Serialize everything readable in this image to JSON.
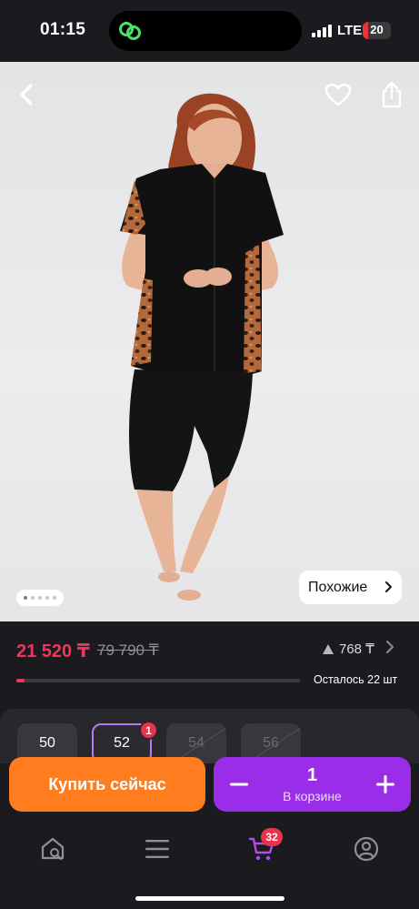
{
  "status_bar": {
    "time": "01:15",
    "network": "LTE",
    "battery": "20",
    "battery_level": 0.2
  },
  "hero": {
    "similar_label": "Похожие",
    "slide_count": 5,
    "active_slide": 1
  },
  "price": {
    "current": "21 520 ₸",
    "old": "79 790 ₸",
    "bonus": "768 ₸",
    "stock_text": "Осталось 22 шт",
    "stock_fraction": 0.03
  },
  "sizes": [
    {
      "label": "50",
      "state": "available"
    },
    {
      "label": "52",
      "state": "selected",
      "badge": "1"
    },
    {
      "label": "54",
      "state": "disabled"
    },
    {
      "label": "56",
      "state": "disabled"
    }
  ],
  "actions": {
    "buy_label": "Купить сейчас",
    "quantity": "1",
    "in_cart_label": "В корзине"
  },
  "nav": {
    "cart_badge": "32"
  },
  "colors": {
    "accent_price": "#f0355b",
    "buy": "#ff7c1f",
    "cart": "#9a2ee8",
    "badge": "#e8334a"
  },
  "icons": {
    "back": "chevron-left-icon",
    "favorite": "heart-icon",
    "share": "share-icon",
    "home": "home-search-icon",
    "catalog": "menu-icon",
    "cart": "cart-icon",
    "profile": "profile-icon"
  }
}
